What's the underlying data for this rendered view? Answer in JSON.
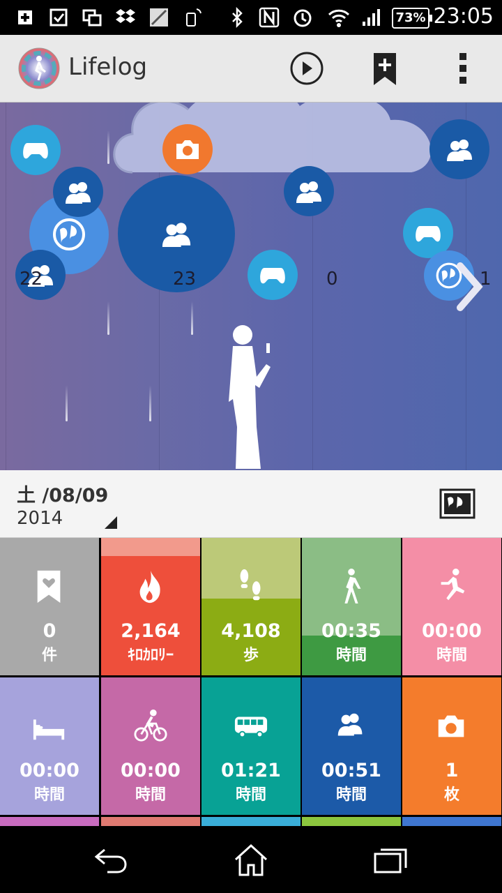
{
  "status_bar": {
    "time": "23:05",
    "battery": "73%",
    "icons": [
      "plus-icon",
      "checkbox-icon",
      "window-icon",
      "dropbox-icon",
      "image-icon",
      "phone-signal-icon",
      "bluetooth-icon",
      "nfc-icon",
      "alarm-icon",
      "wifi-icon",
      "cellular-icon",
      "battery-icon"
    ]
  },
  "app": {
    "title": "Lifelog",
    "actions": [
      "play-icon",
      "bookmark-add-icon",
      "overflow-menu-icon"
    ]
  },
  "timeline": {
    "days": [
      "22",
      "23",
      "0",
      "1"
    ],
    "bubble_icons": [
      "gamepad-icon",
      "camera-icon",
      "friends-icon",
      "globe-icon",
      "friends-icon",
      "friends-icon",
      "gamepad-icon",
      "friends-icon",
      "gamepad-icon",
      "globe-icon",
      "friends-icon"
    ],
    "colors": {
      "gamepad": "#2ea6dc",
      "camera": "#f1782e",
      "friends": "#1a5aa6",
      "globe": "#4a90e2"
    }
  },
  "date": {
    "day": "土 /08/09",
    "year": "2014"
  },
  "tiles": [
    {
      "name": "bookmarks",
      "value": "0",
      "unit": "件",
      "icon": "bookmark-heart-icon",
      "color": "#a9a9a9",
      "fill": 0
    },
    {
      "name": "calories",
      "value": "2,164",
      "unit": "ｷﾛｶﾛﾘｰ",
      "icon": "flame-icon",
      "color": "#f0523e",
      "fill": 0.87
    },
    {
      "name": "steps",
      "value": "4,108",
      "unit": "歩",
      "icon": "footprints-icon",
      "color": "#bcc978",
      "fill": 0.56
    },
    {
      "name": "walking",
      "value": "00:35",
      "unit": "時間",
      "icon": "walking-icon",
      "color": "#8bbd85",
      "fill": 0.29
    },
    {
      "name": "running",
      "value": "00:00",
      "unit": "時間",
      "icon": "running-icon",
      "color": "#f48ea6",
      "fill": 0
    },
    {
      "name": "sleep",
      "value": "00:00",
      "unit": "時間",
      "icon": "bed-icon",
      "color": "#a6a3dc",
      "fill": 0
    },
    {
      "name": "cycling",
      "value": "00:00",
      "unit": "時間",
      "icon": "bicycle-icon",
      "color": "#c569a7",
      "fill": 0
    },
    {
      "name": "transport",
      "value": "01:21",
      "unit": "時間",
      "icon": "bus-icon",
      "color": "#08a295",
      "fill": 0
    },
    {
      "name": "social",
      "value": "00:51",
      "unit": "時間",
      "icon": "friends-icon",
      "color": "#1c5aa8",
      "fill": 0
    },
    {
      "name": "photos",
      "value": "1",
      "unit": "枚",
      "icon": "camera-icon",
      "color": "#f47c2c",
      "fill": 0
    }
  ],
  "nav": [
    "back-icon",
    "home-icon",
    "recents-icon"
  ]
}
